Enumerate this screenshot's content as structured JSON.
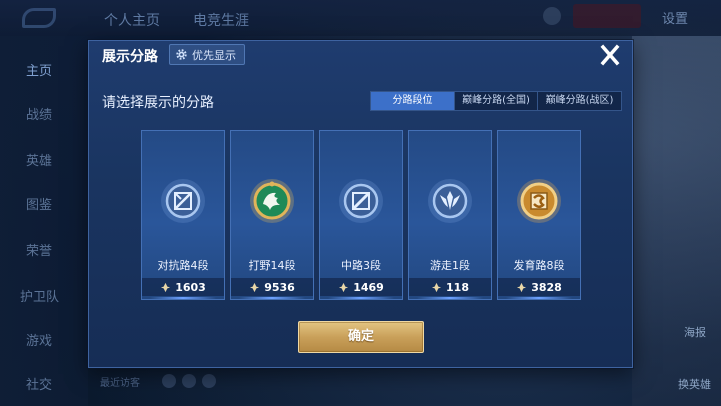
{
  "background": {
    "top_tabs": [
      "个人主页",
      "电竞生涯"
    ],
    "settings_label": "设置",
    "sidebar_items": [
      "主页",
      "战绩",
      "英雄",
      "图鉴",
      "荣誉",
      "护卫队",
      "游戏",
      "社交"
    ],
    "right_labels": [
      "海报",
      "换英雄"
    ],
    "bottom_text": "最近访客"
  },
  "modal": {
    "title": "展示分路",
    "priority_button": "优先显示",
    "prompt": "请选择展示的分路",
    "tabs": [
      {
        "label": "分路段位",
        "active": true
      },
      {
        "label": "巅峰分路(全国)",
        "active": false
      },
      {
        "label": "巅峰分路(战区)",
        "active": false
      }
    ],
    "cards": [
      {
        "label": "对抗路4段",
        "score": "1603",
        "icon": "clash-lane-icon",
        "color": "#8fb6e8"
      },
      {
        "label": "打野14段",
        "score": "9536",
        "icon": "jungle-icon",
        "color": "#2fa56a"
      },
      {
        "label": "中路3段",
        "score": "1469",
        "icon": "mid-lane-icon",
        "color": "#8fb6e8"
      },
      {
        "label": "游走1段",
        "score": "118",
        "icon": "roam-icon",
        "color": "#8fb6e8"
      },
      {
        "label": "发育路8段",
        "score": "3828",
        "icon": "farm-lane-icon",
        "color": "#d9a24a"
      }
    ],
    "confirm_button": "确定"
  },
  "colors": {
    "accent_blue": "#3c70c9",
    "confirm_gold": "#c9a05a",
    "panel": "#1f3c6f"
  }
}
